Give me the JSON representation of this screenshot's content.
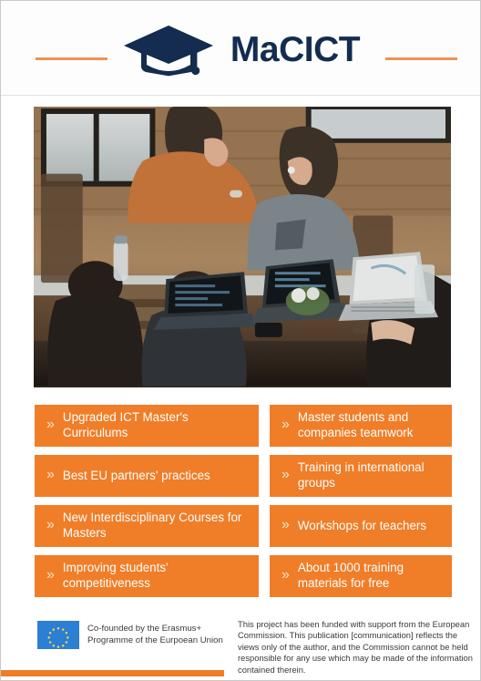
{
  "header": {
    "brand_name": "MaCICT",
    "logo_icon": "graduation-cap-icon",
    "rule_color": "#ef9255",
    "brand_color": "#132c4f"
  },
  "photo": {
    "alt": "Students working together on laptops at a wooden table in a cafe workspace"
  },
  "features": {
    "accent_color": "#f07d28",
    "chevron_glyph": "»",
    "items": [
      {
        "label": "Upgraded ICT Master's Curriculums",
        "column": "left"
      },
      {
        "label": "Master students and companies teamwork",
        "column": "right"
      },
      {
        "label": "Best EU partners' practices",
        "column": "left"
      },
      {
        "label": "Training in international groups",
        "column": "right"
      },
      {
        "label": "New Interdisciplinary Courses for Masters",
        "column": "left"
      },
      {
        "label": "Workshops for teachers",
        "column": "right"
      },
      {
        "label": "Improving students' competitiveness",
        "column": "left"
      },
      {
        "label": "About 1000 training materials for free",
        "column": "right"
      }
    ]
  },
  "footer": {
    "eu_flag_icon": "eu-flag-icon",
    "eu_funding_text": "Co-founded by the Erasmus+ Programme of the Eurpoean Union",
    "disclaimer": "This project has been funded with support from the European Commission. This publication [communication] reflects the views only of the author, and the Commission cannot be held responsible for any use which may be made of the information contained therein.",
    "bar_color": "#ef7d26"
  }
}
